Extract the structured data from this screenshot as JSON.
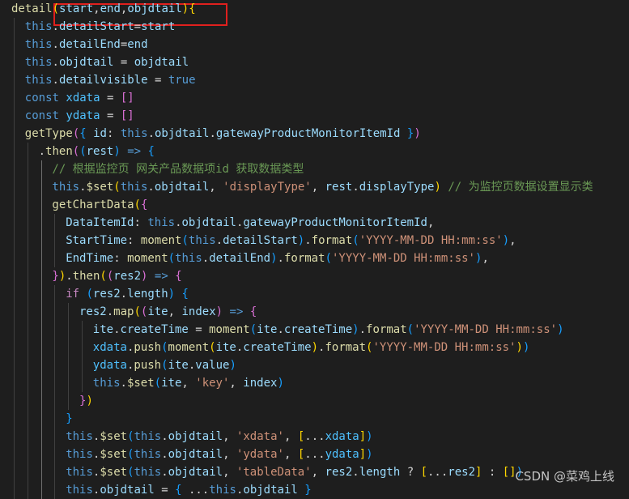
{
  "code_lines": [
    {
      "indent": 0,
      "tokens": [
        [
          "fn",
          "detail"
        ],
        [
          "b1",
          "("
        ],
        [
          "vr",
          "start"
        ],
        [
          "pn",
          ","
        ],
        [
          "vr",
          "end"
        ],
        [
          "pn",
          ","
        ],
        [
          "vr",
          "objdtail"
        ],
        [
          "b1",
          ")"
        ],
        [
          "b1",
          "{"
        ]
      ]
    },
    {
      "indent": 2,
      "tokens": [
        [
          "kw",
          "this"
        ],
        [
          "pn",
          "."
        ],
        [
          "pr",
          "detailStart"
        ],
        [
          "pn",
          "="
        ],
        [
          "vr",
          "start"
        ]
      ]
    },
    {
      "indent": 2,
      "tokens": [
        [
          "kw",
          "this"
        ],
        [
          "pn",
          "."
        ],
        [
          "pr",
          "detailEnd"
        ],
        [
          "pn",
          "="
        ],
        [
          "vr",
          "end"
        ]
      ]
    },
    {
      "indent": 2,
      "tokens": [
        [
          "kw",
          "this"
        ],
        [
          "pn",
          "."
        ],
        [
          "pr",
          "objdtail"
        ],
        [
          "pn",
          " = "
        ],
        [
          "vr",
          "objdtail"
        ]
      ]
    },
    {
      "indent": 2,
      "tokens": [
        [
          "kw",
          "this"
        ],
        [
          "pn",
          "."
        ],
        [
          "pr",
          "detailvisible"
        ],
        [
          "pn",
          " = "
        ],
        [
          "kw",
          "true"
        ]
      ]
    },
    {
      "indent": 2,
      "tokens": [
        [
          "kw",
          "const"
        ],
        [
          "pn",
          " "
        ],
        [
          "cst",
          "xdata"
        ],
        [
          "pn",
          " = "
        ],
        [
          "b2",
          "[]"
        ]
      ]
    },
    {
      "indent": 2,
      "tokens": [
        [
          "kw",
          "const"
        ],
        [
          "pn",
          " "
        ],
        [
          "cst",
          "ydata"
        ],
        [
          "pn",
          " = "
        ],
        [
          "b2",
          "[]"
        ]
      ]
    },
    {
      "indent": 2,
      "tokens": [
        [
          "fn",
          "getType"
        ],
        [
          "b2",
          "("
        ],
        [
          "b3",
          "{"
        ],
        [
          "pn",
          " "
        ],
        [
          "pr",
          "id"
        ],
        [
          "pn",
          ": "
        ],
        [
          "kw",
          "this"
        ],
        [
          "pn",
          "."
        ],
        [
          "pr",
          "objdtail"
        ],
        [
          "pn",
          "."
        ],
        [
          "pr",
          "gatewayProductMonitorItemId"
        ],
        [
          "pn",
          " "
        ],
        [
          "b3",
          "}"
        ],
        [
          "b2",
          ")"
        ]
      ]
    },
    {
      "indent": 4,
      "tokens": [
        [
          "pn",
          "."
        ],
        [
          "fn",
          "then"
        ],
        [
          "b2",
          "("
        ],
        [
          "b3",
          "("
        ],
        [
          "vr",
          "rest"
        ],
        [
          "b3",
          ")"
        ],
        [
          "pn",
          " "
        ],
        [
          "kw",
          "=>"
        ],
        [
          "pn",
          " "
        ],
        [
          "b3",
          "{"
        ]
      ]
    },
    {
      "indent": 6,
      "tokens": [
        [
          "cm",
          "// 根据监控页 网关产品数据项id 获取数据类型"
        ]
      ]
    },
    {
      "indent": 6,
      "tokens": [
        [
          "kw",
          "this"
        ],
        [
          "pn",
          "."
        ],
        [
          "fn",
          "$set"
        ],
        [
          "b1",
          "("
        ],
        [
          "kw",
          "this"
        ],
        [
          "pn",
          "."
        ],
        [
          "pr",
          "objdtail"
        ],
        [
          "pn",
          ", "
        ],
        [
          "str",
          "'displayType'"
        ],
        [
          "pn",
          ", "
        ],
        [
          "vr",
          "rest"
        ],
        [
          "pn",
          "."
        ],
        [
          "pr",
          "displayType"
        ],
        [
          "b1",
          ")"
        ],
        [
          "pn",
          " "
        ],
        [
          "cm",
          "// 为监控页数据设置显示类"
        ]
      ]
    },
    {
      "indent": 6,
      "tokens": [
        [
          "fn",
          "getChartData"
        ],
        [
          "b1",
          "("
        ],
        [
          "b2",
          "{"
        ]
      ]
    },
    {
      "indent": 8,
      "tokens": [
        [
          "pr",
          "DataItemId"
        ],
        [
          "pn",
          ": "
        ],
        [
          "kw",
          "this"
        ],
        [
          "pn",
          "."
        ],
        [
          "pr",
          "objdtail"
        ],
        [
          "pn",
          "."
        ],
        [
          "pr",
          "gatewayProductMonitorItemId"
        ],
        [
          "pn",
          ","
        ]
      ]
    },
    {
      "indent": 8,
      "tokens": [
        [
          "pr",
          "StartTime"
        ],
        [
          "pn",
          ": "
        ],
        [
          "fn",
          "moment"
        ],
        [
          "b3",
          "("
        ],
        [
          "kw",
          "this"
        ],
        [
          "pn",
          "."
        ],
        [
          "pr",
          "detailStart"
        ],
        [
          "b3",
          ")"
        ],
        [
          "pn",
          "."
        ],
        [
          "fn",
          "format"
        ],
        [
          "b3",
          "("
        ],
        [
          "str",
          "'YYYY-MM-DD HH:mm:ss'"
        ],
        [
          "b3",
          ")"
        ],
        [
          "pn",
          ","
        ]
      ]
    },
    {
      "indent": 8,
      "tokens": [
        [
          "pr",
          "EndTime"
        ],
        [
          "pn",
          ": "
        ],
        [
          "fn",
          "moment"
        ],
        [
          "b3",
          "("
        ],
        [
          "kw",
          "this"
        ],
        [
          "pn",
          "."
        ],
        [
          "pr",
          "detailEnd"
        ],
        [
          "b3",
          ")"
        ],
        [
          "pn",
          "."
        ],
        [
          "fn",
          "format"
        ],
        [
          "b3",
          "("
        ],
        [
          "str",
          "'YYYY-MM-DD HH:mm:ss'"
        ],
        [
          "b3",
          ")"
        ],
        [
          "pn",
          ","
        ]
      ]
    },
    {
      "indent": 6,
      "tokens": [
        [
          "b2",
          "}"
        ],
        [
          "b1",
          ")"
        ],
        [
          "pn",
          "."
        ],
        [
          "fn",
          "then"
        ],
        [
          "b1",
          "("
        ],
        [
          "b2",
          "("
        ],
        [
          "vr",
          "res2"
        ],
        [
          "b2",
          ")"
        ],
        [
          "pn",
          " "
        ],
        [
          "kw",
          "=>"
        ],
        [
          "pn",
          " "
        ],
        [
          "b2",
          "{"
        ]
      ]
    },
    {
      "indent": 8,
      "tokens": [
        [
          "ctl",
          "if"
        ],
        [
          "pn",
          " "
        ],
        [
          "b3",
          "("
        ],
        [
          "vr",
          "res2"
        ],
        [
          "pn",
          "."
        ],
        [
          "pr",
          "length"
        ],
        [
          "b3",
          ")"
        ],
        [
          "pn",
          " "
        ],
        [
          "b3",
          "{"
        ]
      ]
    },
    {
      "indent": 10,
      "tokens": [
        [
          "vr",
          "res2"
        ],
        [
          "pn",
          "."
        ],
        [
          "fn",
          "map"
        ],
        [
          "b1",
          "("
        ],
        [
          "b2",
          "("
        ],
        [
          "vr",
          "ite"
        ],
        [
          "pn",
          ", "
        ],
        [
          "vr",
          "index"
        ],
        [
          "b2",
          ")"
        ],
        [
          "pn",
          " "
        ],
        [
          "kw",
          "=>"
        ],
        [
          "pn",
          " "
        ],
        [
          "b2",
          "{"
        ]
      ]
    },
    {
      "indent": 12,
      "tokens": [
        [
          "vr",
          "ite"
        ],
        [
          "pn",
          "."
        ],
        [
          "pr",
          "createTime"
        ],
        [
          "pn",
          " = "
        ],
        [
          "fn",
          "moment"
        ],
        [
          "b3",
          "("
        ],
        [
          "vr",
          "ite"
        ],
        [
          "pn",
          "."
        ],
        [
          "pr",
          "createTime"
        ],
        [
          "b3",
          ")"
        ],
        [
          "pn",
          "."
        ],
        [
          "fn",
          "format"
        ],
        [
          "b3",
          "("
        ],
        [
          "str",
          "'YYYY-MM-DD HH:mm:ss'"
        ],
        [
          "b3",
          ")"
        ]
      ]
    },
    {
      "indent": 12,
      "tokens": [
        [
          "cst",
          "xdata"
        ],
        [
          "pn",
          "."
        ],
        [
          "fn",
          "push"
        ],
        [
          "b3",
          "("
        ],
        [
          "fn",
          "moment"
        ],
        [
          "b1",
          "("
        ],
        [
          "vr",
          "ite"
        ],
        [
          "pn",
          "."
        ],
        [
          "pr",
          "createTime"
        ],
        [
          "b1",
          ")"
        ],
        [
          "pn",
          "."
        ],
        [
          "fn",
          "format"
        ],
        [
          "b1",
          "("
        ],
        [
          "str",
          "'YYYY-MM-DD HH:mm:ss'"
        ],
        [
          "b1",
          ")"
        ],
        [
          "b3",
          ")"
        ]
      ]
    },
    {
      "indent": 12,
      "tokens": [
        [
          "cst",
          "ydata"
        ],
        [
          "pn",
          "."
        ],
        [
          "fn",
          "push"
        ],
        [
          "b3",
          "("
        ],
        [
          "vr",
          "ite"
        ],
        [
          "pn",
          "."
        ],
        [
          "pr",
          "value"
        ],
        [
          "b3",
          ")"
        ]
      ]
    },
    {
      "indent": 12,
      "tokens": [
        [
          "kw",
          "this"
        ],
        [
          "pn",
          "."
        ],
        [
          "fn",
          "$set"
        ],
        [
          "b3",
          "("
        ],
        [
          "vr",
          "ite"
        ],
        [
          "pn",
          ", "
        ],
        [
          "str",
          "'key'"
        ],
        [
          "pn",
          ", "
        ],
        [
          "vr",
          "index"
        ],
        [
          "b3",
          ")"
        ]
      ]
    },
    {
      "indent": 10,
      "tokens": [
        [
          "b2",
          "}"
        ],
        [
          "b1",
          ")"
        ]
      ]
    },
    {
      "indent": 8,
      "tokens": [
        [
          "b3",
          "}"
        ]
      ]
    },
    {
      "indent": 8,
      "tokens": [
        [
          "kw",
          "this"
        ],
        [
          "pn",
          "."
        ],
        [
          "fn",
          "$set"
        ],
        [
          "b3",
          "("
        ],
        [
          "kw",
          "this"
        ],
        [
          "pn",
          "."
        ],
        [
          "pr",
          "objdtail"
        ],
        [
          "pn",
          ", "
        ],
        [
          "str",
          "'xdata'"
        ],
        [
          "pn",
          ", "
        ],
        [
          "b1",
          "["
        ],
        [
          "pn",
          "..."
        ],
        [
          "cst",
          "xdata"
        ],
        [
          "b1",
          "]"
        ],
        [
          "b3",
          ")"
        ]
      ]
    },
    {
      "indent": 8,
      "tokens": [
        [
          "kw",
          "this"
        ],
        [
          "pn",
          "."
        ],
        [
          "fn",
          "$set"
        ],
        [
          "b3",
          "("
        ],
        [
          "kw",
          "this"
        ],
        [
          "pn",
          "."
        ],
        [
          "pr",
          "objdtail"
        ],
        [
          "pn",
          ", "
        ],
        [
          "str",
          "'ydata'"
        ],
        [
          "pn",
          ", "
        ],
        [
          "b1",
          "["
        ],
        [
          "pn",
          "..."
        ],
        [
          "cst",
          "ydata"
        ],
        [
          "b1",
          "]"
        ],
        [
          "b3",
          ")"
        ]
      ]
    },
    {
      "indent": 8,
      "tokens": [
        [
          "kw",
          "this"
        ],
        [
          "pn",
          "."
        ],
        [
          "fn",
          "$set"
        ],
        [
          "b3",
          "("
        ],
        [
          "kw",
          "this"
        ],
        [
          "pn",
          "."
        ],
        [
          "pr",
          "objdtail"
        ],
        [
          "pn",
          ", "
        ],
        [
          "str",
          "'tableData'"
        ],
        [
          "pn",
          ", "
        ],
        [
          "vr",
          "res2"
        ],
        [
          "pn",
          "."
        ],
        [
          "pr",
          "length"
        ],
        [
          "pn",
          " ? "
        ],
        [
          "b1",
          "["
        ],
        [
          "pn",
          "..."
        ],
        [
          "vr",
          "res2"
        ],
        [
          "b1",
          "]"
        ],
        [
          "pn",
          " : "
        ],
        [
          "b1",
          "[]"
        ],
        [
          "b3",
          ")"
        ]
      ]
    },
    {
      "indent": 8,
      "tokens": [
        [
          "kw",
          "this"
        ],
        [
          "pn",
          "."
        ],
        [
          "pr",
          "objdtail"
        ],
        [
          "pn",
          " = "
        ],
        [
          "b3",
          "{"
        ],
        [
          "pn",
          " ..."
        ],
        [
          "kw",
          "this"
        ],
        [
          "pn",
          "."
        ],
        [
          "pr",
          "objdtail"
        ],
        [
          "pn",
          " "
        ],
        [
          "b3",
          "}"
        ]
      ]
    }
  ],
  "watermark": "CSDN @菜鸡上线"
}
